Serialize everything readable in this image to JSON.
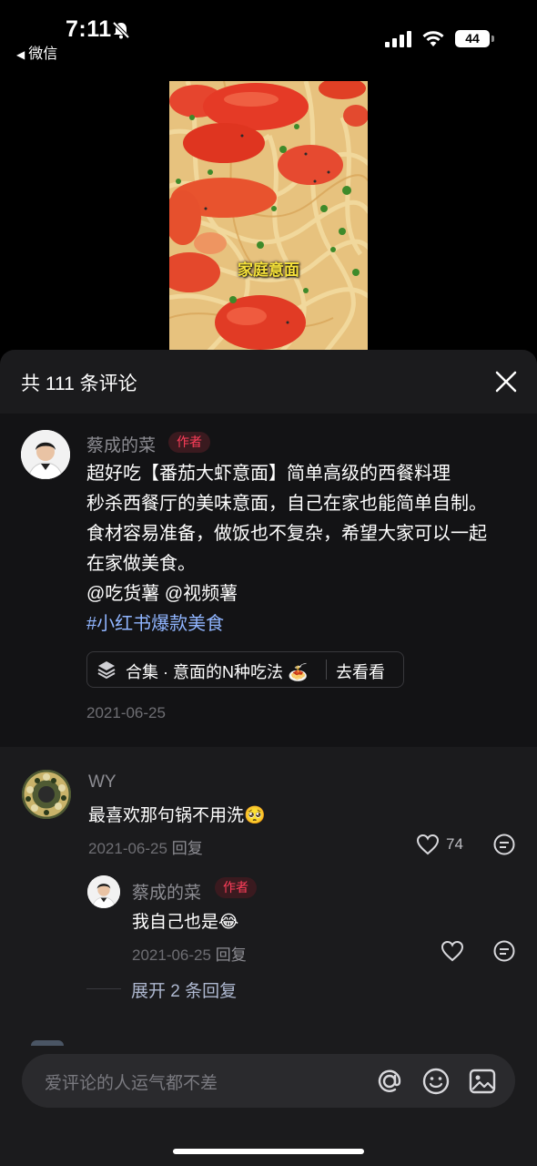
{
  "status_bar": {
    "time": "7:11",
    "back_app": "微信",
    "battery": "44"
  },
  "video": {
    "caption": "家庭意面"
  },
  "comments_header": {
    "title": "共 111 条评论"
  },
  "post": {
    "author": "蔡成的菜",
    "author_badge": "作者",
    "lines": [
      "超好吃【番茄大虾意面】简单高级的西餐料理",
      "秒杀西餐厅的美味意面，自己在家也能简单自制。",
      "食材容易准备，做饭也不复杂，希望大家可以一起",
      "在家做美食。",
      "@吃货薯 @视频薯"
    ],
    "hashtag": "#小红书爆款美食",
    "collection_label": "合集 · 意面的N种吃法 🍝",
    "collection_action": "去看看",
    "date": "2021-06-25"
  },
  "comments": [
    {
      "user": "WY",
      "text": "最喜欢那句锅不用洗🥺",
      "date": "2021-06-25",
      "reply_label": "回复",
      "likes": "74",
      "replies": [
        {
          "user": "蔡成的菜",
          "badge": "作者",
          "text": "我自己也是😂",
          "date": "2021-06-25",
          "reply_label": "回复"
        }
      ],
      "expand_label": "展开 2 条回复"
    }
  ],
  "input": {
    "placeholder": "爱评论的人运气都不差"
  },
  "colors": {
    "sheet_bg": "#1b1b1d",
    "post_bg": "#131315",
    "accent": "#ff3e5a",
    "hashtag": "#90b5ff"
  },
  "icons": [
    "bell-slash-icon",
    "signal-icon",
    "wifi-icon",
    "battery-icon",
    "close-icon",
    "stack-icon",
    "heart-icon",
    "reply-bubble-icon",
    "at-icon",
    "emoji-icon",
    "image-icon"
  ]
}
